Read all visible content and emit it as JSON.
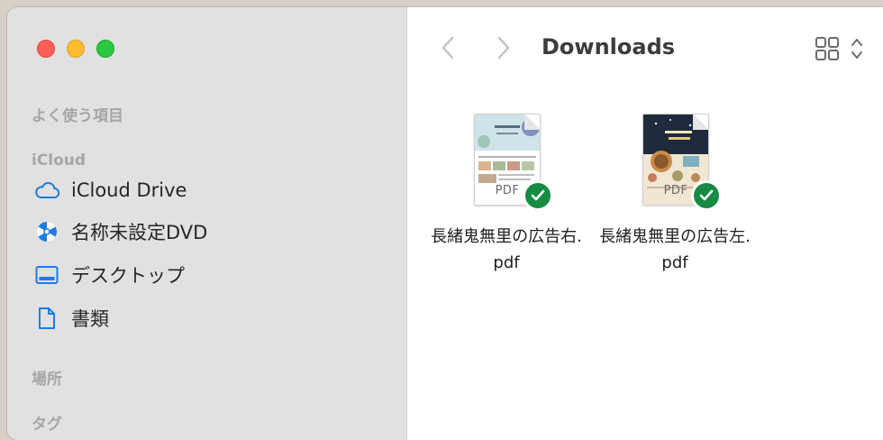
{
  "window": {
    "title": "Downloads"
  },
  "sidebar": {
    "sections": [
      {
        "header": "よく使う項目"
      },
      {
        "header": "iCloud"
      }
    ],
    "items": [
      {
        "label": "iCloud Drive",
        "icon": "cloud-icon"
      },
      {
        "label": "名称未設定DVD",
        "icon": "disc-icon"
      },
      {
        "label": "デスクトップ",
        "icon": "desktop-icon"
      },
      {
        "label": "書類",
        "icon": "document-icon"
      }
    ],
    "more_sections": [
      {
        "header": "場所"
      },
      {
        "header": "タグ"
      }
    ]
  },
  "files": [
    {
      "name": "長緒鬼無里の広告右.pdf",
      "type_label": "PDF",
      "status": "synced"
    },
    {
      "name": "長緒鬼無里の広告左.pdf",
      "type_label": "PDF",
      "status": "synced"
    }
  ],
  "colors": {
    "sidebar_bg": "#e1e1e1",
    "accent_icon": "#1f7ce0",
    "sync_badge": "#178a44"
  }
}
